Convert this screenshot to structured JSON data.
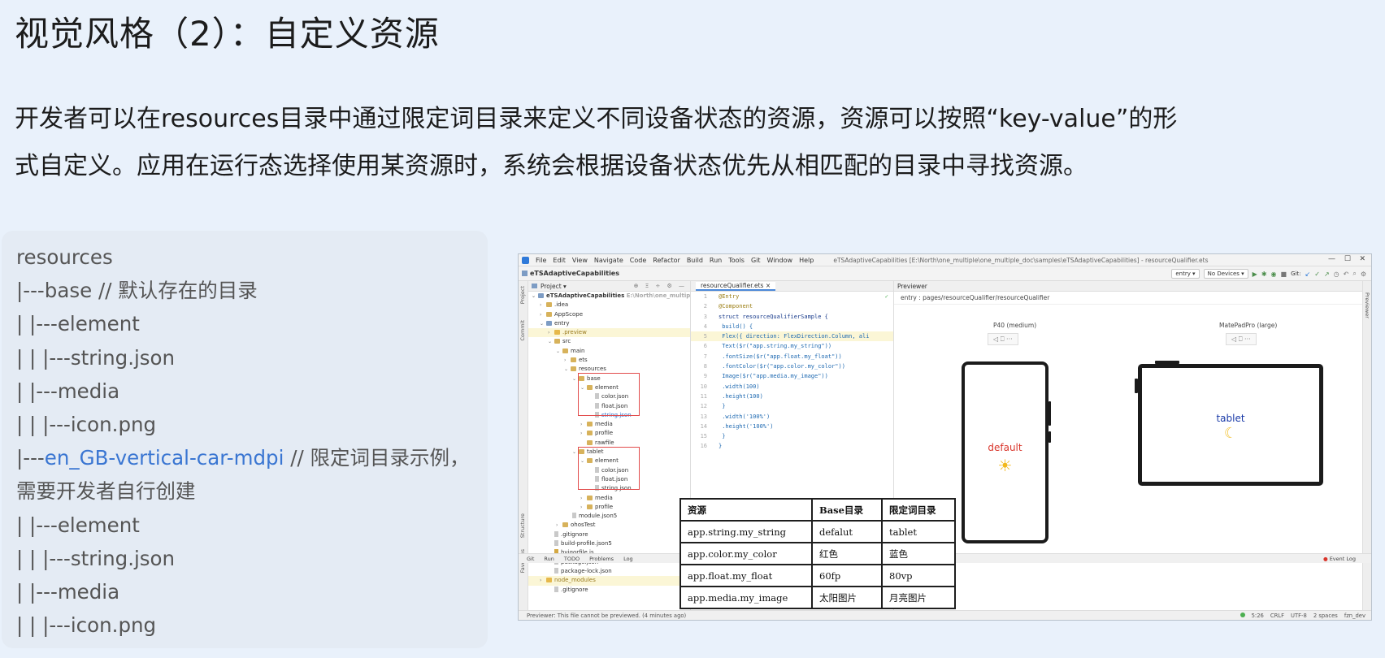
{
  "slide": {
    "title": "视觉风格（2）：自定义资源",
    "intro_line1": "开发者可以在resources目录中通过限定词目录来定义不同设备状态的资源，资源可以按照“key-value”的形",
    "intro_line2": "式自定义。应用在运行态选择使用某资源时，系统会根据设备状态优先从相匹配的目录中寻找资源。"
  },
  "resource_tree": {
    "lines": [
      "resources",
      "|---base  // 默认存在的目录",
      "|  |---element",
      "|  |  |---string.json",
      "|  |---media",
      "|  |  |---icon.png"
    ],
    "qualifier_prefix": "|---",
    "qualifier_name": "en_GB-vertical-car-mdpi",
    "qualifier_comment": " // 限定词目录示例，需要开发者自行创建",
    "lines_after": [
      "|  |---element",
      "|  |  |---string.json",
      "|  |---media",
      "|  |  |---icon.png"
    ]
  },
  "ide": {
    "menus": [
      "File",
      "Edit",
      "View",
      "Navigate",
      "Code",
      "Refactor",
      "Build",
      "Run",
      "Tools",
      "Git",
      "Window",
      "Help"
    ],
    "window_title": "eTSAdaptiveCapabilities [E:\\North\\one_multiple\\one_multiple_doc\\samples\\eTSAdaptiveCapabilities] - resourceQualifier.ets",
    "window_buttons": [
      "—",
      "☐",
      "✕"
    ],
    "project_name": "eTSAdaptiveCapabilities",
    "toolbar_module": "entry ▾",
    "toolbar_device": "No Devices ▾",
    "toolbar_git": "Git:",
    "side_labels": [
      "Project",
      "Commit",
      "Structure",
      "Favorites"
    ],
    "right_side_label": "Previewer",
    "project_pane_title": "Project ▾",
    "project_pane_controls": "⊕ Ξ ÷ ⚙ —",
    "tree": [
      {
        "label": "eTSAdaptiveCapabilities",
        "extra": "E:\\North\\one_multiple\\on"
      },
      {
        "label": ".idea"
      },
      {
        "label": "AppScope"
      },
      {
        "label": "entry"
      },
      {
        "label": ".preview"
      },
      {
        "label": "src"
      },
      {
        "label": "main"
      },
      {
        "label": "ets"
      },
      {
        "label": "resources"
      },
      {
        "label": "base"
      },
      {
        "label": "element"
      },
      {
        "label": "color.json"
      },
      {
        "label": "float.json"
      },
      {
        "label": "string.json"
      },
      {
        "label": "media"
      },
      {
        "label": "profile"
      },
      {
        "label": "rawfile"
      },
      {
        "label": "tablet"
      },
      {
        "label": "element"
      },
      {
        "label": "color.json"
      },
      {
        "label": "float.json"
      },
      {
        "label": "string.json"
      },
      {
        "label": "media"
      },
      {
        "label": "profile"
      },
      {
        "label": "module.json5"
      },
      {
        "label": "ohosTest"
      },
      {
        "label": ".gitignore"
      },
      {
        "label": "build-profile.json5"
      },
      {
        "label": "hvigorfile.js"
      },
      {
        "label": "package.json"
      },
      {
        "label": "package-lock.json"
      },
      {
        "label": "node_modules"
      },
      {
        "label": ".gitignore"
      }
    ],
    "editor_tab": "resourceQualifier.ets ×",
    "code_lines": [
      "@Entry",
      "@Component",
      "struct resourceQualifierSample {",
      "  build() {",
      "    Flex({ direction: FlexDirection.Column, ali",
      "      Text($r(\"app.string.my_string\"))",
      "        .fontSize($r(\"app.float.my_float\"))",
      "        .fontColor($r(\"app.color.my_color\"))",
      "      Image($r(\"app.media.my_image\"))",
      "        .width(100)",
      "        .height(100)",
      "    }",
      "    .width('100%')",
      "    .height('100%')",
      "  }",
      "}"
    ],
    "previewer_title": "Previewer",
    "previewer_path": "entry : pages/resourceQualifier/resourceQualifier",
    "device1_label": "P40 (medium)",
    "device2_label": "MatePadPro (large)",
    "device1_text": "default",
    "device2_text": "tablet",
    "device_controls": "◁  ⎕  ···",
    "bottom_tools": [
      "Git",
      "Run",
      "TODO",
      "Problems",
      "Log"
    ],
    "event_log": "Event Log",
    "status_left": "Previewer: This file cannot be previewed. (4 minutes ago)",
    "status_right": [
      "5:26",
      "CRLF",
      "UTF-8",
      "2 spaces",
      "fzn_dev"
    ]
  },
  "resource_table": {
    "headers": [
      "资源",
      "Base目录",
      "限定词目录"
    ],
    "rows": [
      [
        "app.string.my_string",
        "defalut",
        "tablet"
      ],
      [
        "app.color.my_color",
        "红色",
        "蓝色"
      ],
      [
        "app.float.my_float",
        "60fp",
        "80vp"
      ],
      [
        "app.media.my_image",
        "太阳图片",
        "月亮图片"
      ]
    ]
  },
  "colors": {
    "background": "#e9f1fb",
    "qualifier_highlight": "#3a76d2",
    "default_text": "#d9352b",
    "tablet_text": "#1a3aa8",
    "redbox": "#e24c4c"
  }
}
